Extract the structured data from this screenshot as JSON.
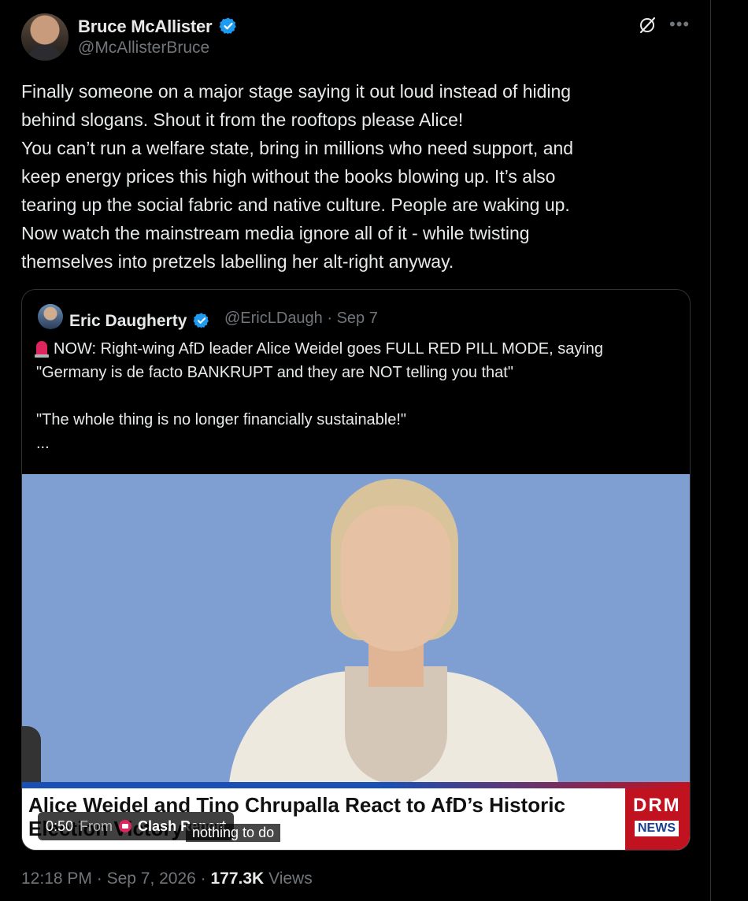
{
  "tweet": {
    "author_name": "Bruce McAllister",
    "handle": "@McAllisterBruce",
    "text_lines": [
      "Finally someone on a major stage saying it out loud instead of hiding",
      "behind slogans. Shout it from the rooftops please Alice!",
      "You can’t run a welfare state, bring in millions who need support, and",
      "keep energy prices this high without the books blowing up. It’s also",
      "tearing up the social fabric and native culture. People are waking up.",
      "Now watch the mainstream media ignore all of it - while twisting",
      "themselves into pretzels labelling her alt-right anyway."
    ],
    "time": "12:18 PM",
    "date": "Sep 7, 2026",
    "views_count": "177.3K",
    "views_label": "Views",
    "icons": {
      "verified": "verified-badge-icon",
      "grok": "grok-icon",
      "more": "more-icon"
    }
  },
  "quoted": {
    "author_name": "Eric Daugherty",
    "handle": "@EricLDaugh",
    "date": "Sep 7",
    "text_lines": [
      "NOW: Right-wing AfD leader Alice Weidel goes FULL RED PILL MODE, saying",
      "\"Germany is de facto BANKRUPT and they are NOT telling you that\"",
      "",
      "\"The whole thing is no longer financially sustainable!\"",
      "..."
    ],
    "video": {
      "headline_line1": "Alice Weidel and Tino Chrupalla React to AfD’s Historic",
      "headline_line2": "Election Victory",
      "logo_text": "DRM",
      "logo_badge": "NEWS",
      "duration": "0:50",
      "from_label": "From",
      "source": "Clash Report",
      "caption": "nothing to do"
    }
  },
  "colors": {
    "background": "#000000",
    "text": "#e7e9ea",
    "muted": "#71767b",
    "verified": "#1d9bf0",
    "border": "#2f3336"
  }
}
